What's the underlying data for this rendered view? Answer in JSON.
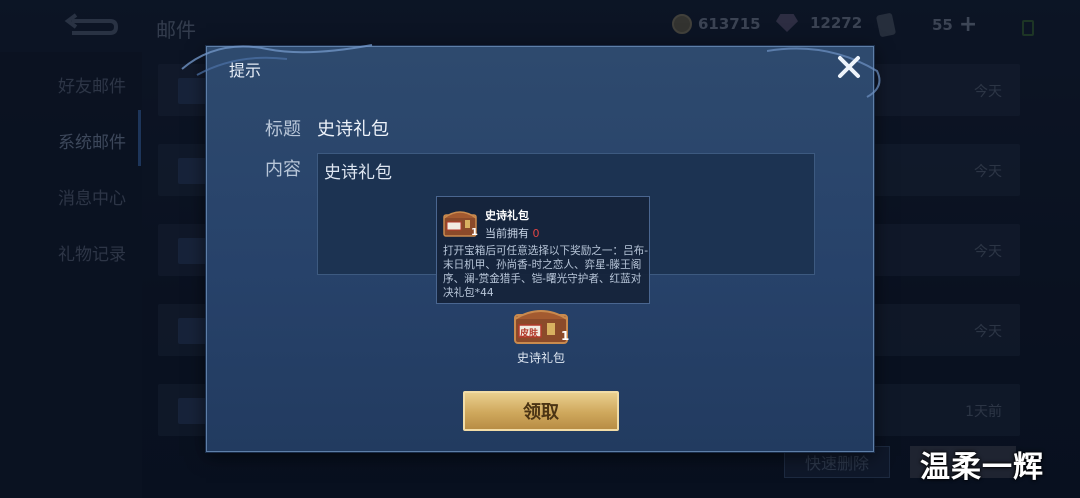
{
  "header": {
    "title": "邮件",
    "gold": "613715",
    "diamonds": "12272",
    "tickets": "55"
  },
  "sidebar": {
    "items": [
      {
        "label": "好友邮件"
      },
      {
        "label": "系统邮件"
      },
      {
        "label": "消息中心"
      },
      {
        "label": "礼物记录"
      }
    ]
  },
  "mail_list": {
    "times": [
      "今天",
      "今天",
      "今天",
      "今天",
      "1天前"
    ]
  },
  "footer": {
    "quick_delete": "快速删除"
  },
  "watermark": "温柔一辉",
  "modal": {
    "title": "提示",
    "subject_label": "标题",
    "subject_value": "史诗礼包",
    "content_label": "内容",
    "content_value": "史诗礼包",
    "attachment": {
      "name": "史诗礼包",
      "count": "1",
      "chest_label": "皮肤"
    },
    "claim_button": "领取"
  },
  "tooltip": {
    "name": "史诗礼包",
    "owned_label": "当前拥有",
    "owned_value": "0",
    "count": "1",
    "description": "打开宝箱后可任意选择以下奖励之一：吕布-末日机甲、孙尚香-时之恋人、弈星-滕王阁序、澜-赏金猎手、铠-曙光守护者、红蓝对决礼包*44"
  },
  "colors": {
    "modal_bg": "#2b4569",
    "claim_gold": "#cfa85c",
    "owned_zero": "#e04545"
  }
}
